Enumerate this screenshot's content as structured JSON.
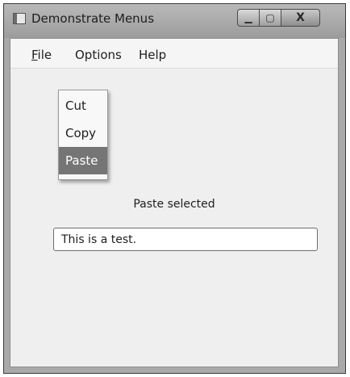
{
  "window": {
    "title": "Demonstrate Menus",
    "controls": {
      "minimize": "▁",
      "maximize": "▢",
      "close": "X"
    }
  },
  "menubar": {
    "file": {
      "mnemonic": "F",
      "rest": "ile"
    },
    "options": "Options",
    "help": "Help"
  },
  "popup": {
    "items": [
      {
        "label": "Cut"
      },
      {
        "label": "Copy"
      },
      {
        "label": "Paste",
        "selected": true
      }
    ]
  },
  "status_text": "Paste selected",
  "textbox": {
    "value": "This is a test."
  },
  "colors": {
    "selection": "#757575",
    "client_bg": "#efefef",
    "frame": "#a9a9a9"
  }
}
